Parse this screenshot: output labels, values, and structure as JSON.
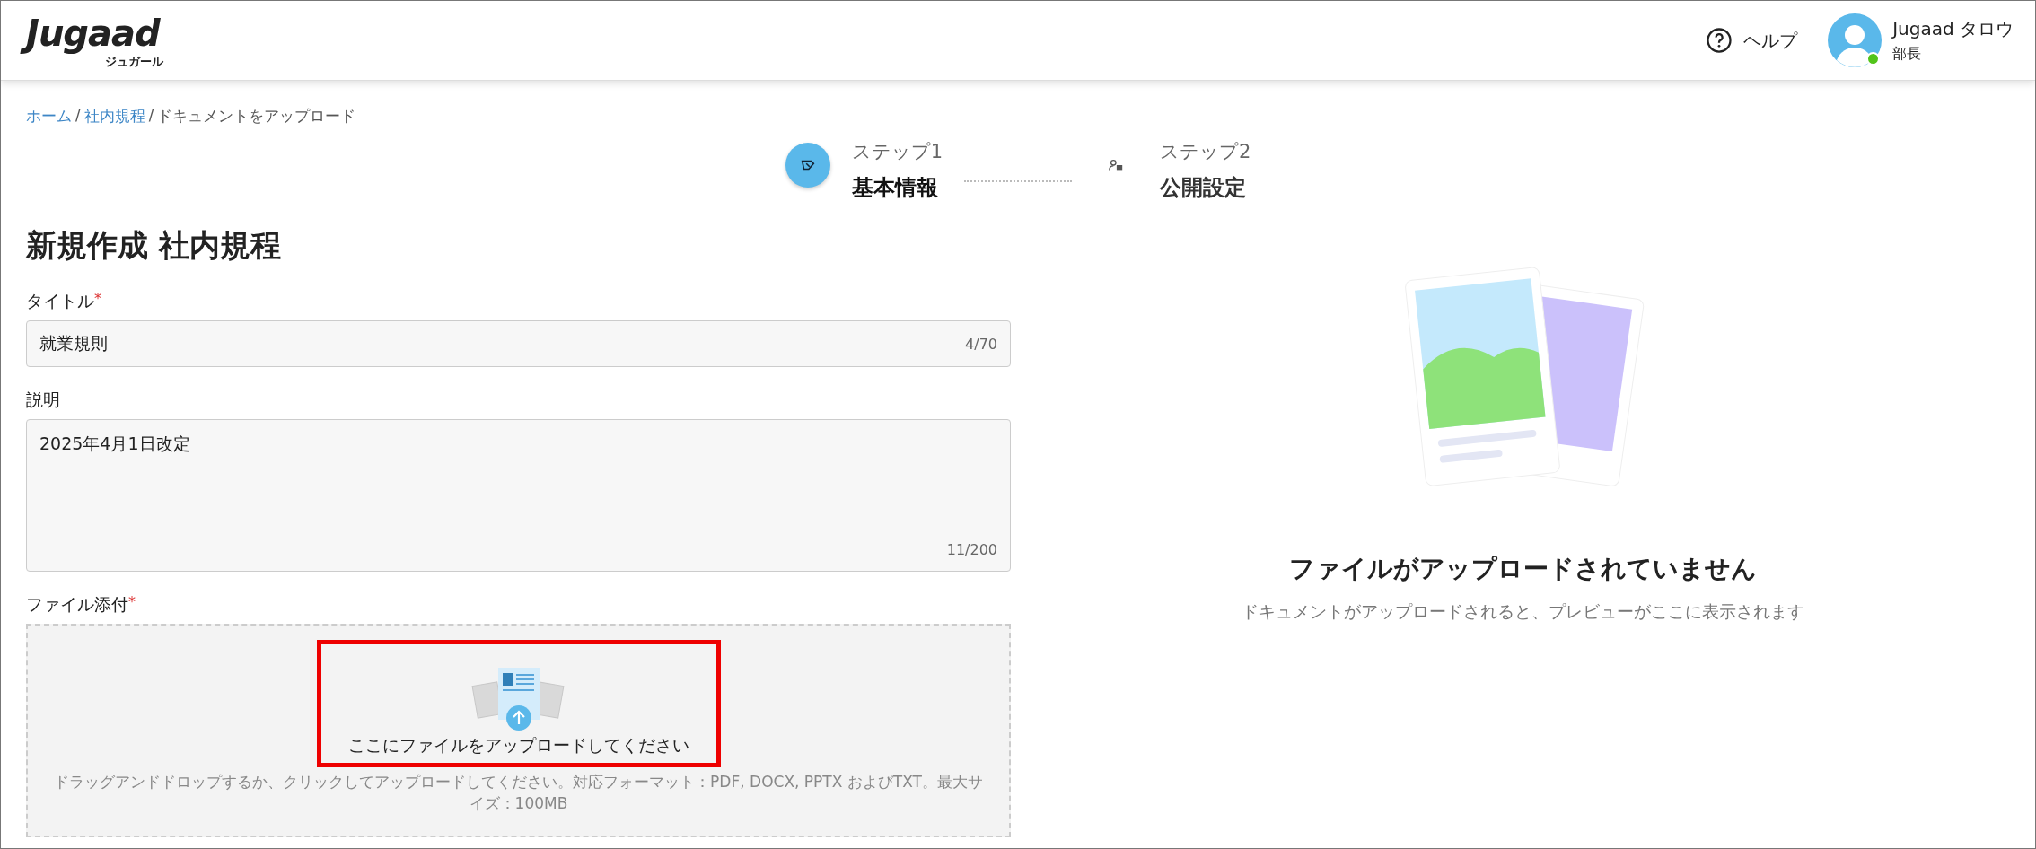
{
  "header": {
    "logo": "Jugaad",
    "logo_sub": "ジュガール",
    "help": "ヘルプ",
    "user": {
      "name": "Jugaad タロウ",
      "role": "部長",
      "online": true
    }
  },
  "breadcrumb": [
    {
      "label": "ホーム",
      "link": true
    },
    {
      "separator": "/"
    },
    {
      "label": "社内規程",
      "link": true
    },
    {
      "separator": "/"
    },
    {
      "label": "ドキュメントをアップロード",
      "link": false
    }
  ],
  "steps": [
    {
      "step": "ステップ1",
      "label": "基本情報",
      "selected": true
    },
    {
      "step": "ステップ2",
      "label": "公開設定",
      "selected": false
    }
  ],
  "page_title": "新規作成 社内規程",
  "fields": [
    {
      "kind": "input",
      "label": "タイトル",
      "required_mark": "*",
      "value": "就業規則",
      "counter": "4/70"
    },
    {
      "kind": "textarea",
      "label": "説明",
      "value": "2025年4月1日改定",
      "counter": "11/200"
    }
  ],
  "upload": {
    "label": "ファイル添付",
    "required_mark": "*",
    "prompt": "ここにファイルをアップロードしてください",
    "hint": "ドラッグアンドドロップするか、クリックしてアップロードしてください。対応フォーマット：PDF, DOCX, PPTX およびTXT。最大サイズ：100MB"
  },
  "preview": {
    "title": "ファイルがアップロードされていません",
    "subtitle": "ドキュメントがアップロードされると、プレビューがここに表示されます"
  }
}
